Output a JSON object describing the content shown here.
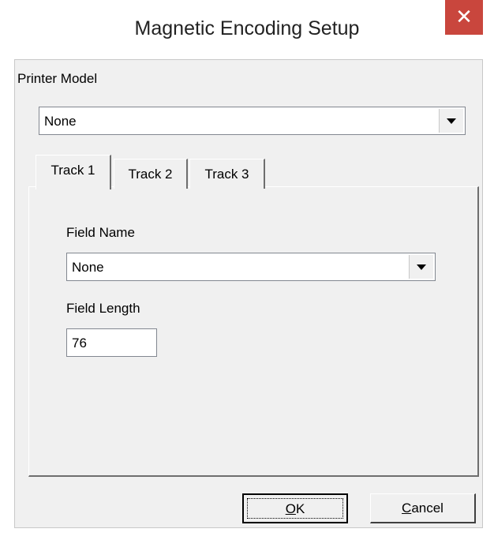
{
  "window": {
    "title": "Magnetic Encoding Setup"
  },
  "printer_model": {
    "label": "Printer Model",
    "selected": "None"
  },
  "tabs": [
    {
      "label": "Track 1",
      "active": true
    },
    {
      "label": "Track 2",
      "active": false
    },
    {
      "label": "Track 3",
      "active": false
    }
  ],
  "track_panel": {
    "field_name_label": "Field Name",
    "field_name_value": "None",
    "field_length_label": "Field Length",
    "field_length_value": "76"
  },
  "buttons": {
    "ok_mnemonic": "O",
    "ok_rest": "K",
    "cancel_mnemonic": "C",
    "cancel_rest": "ancel"
  },
  "icons": {
    "close": "close-icon",
    "dropdown": "chevron-down-icon"
  },
  "colors": {
    "close_button": "#c9463d",
    "dialog_bg": "#f0f0f0"
  }
}
